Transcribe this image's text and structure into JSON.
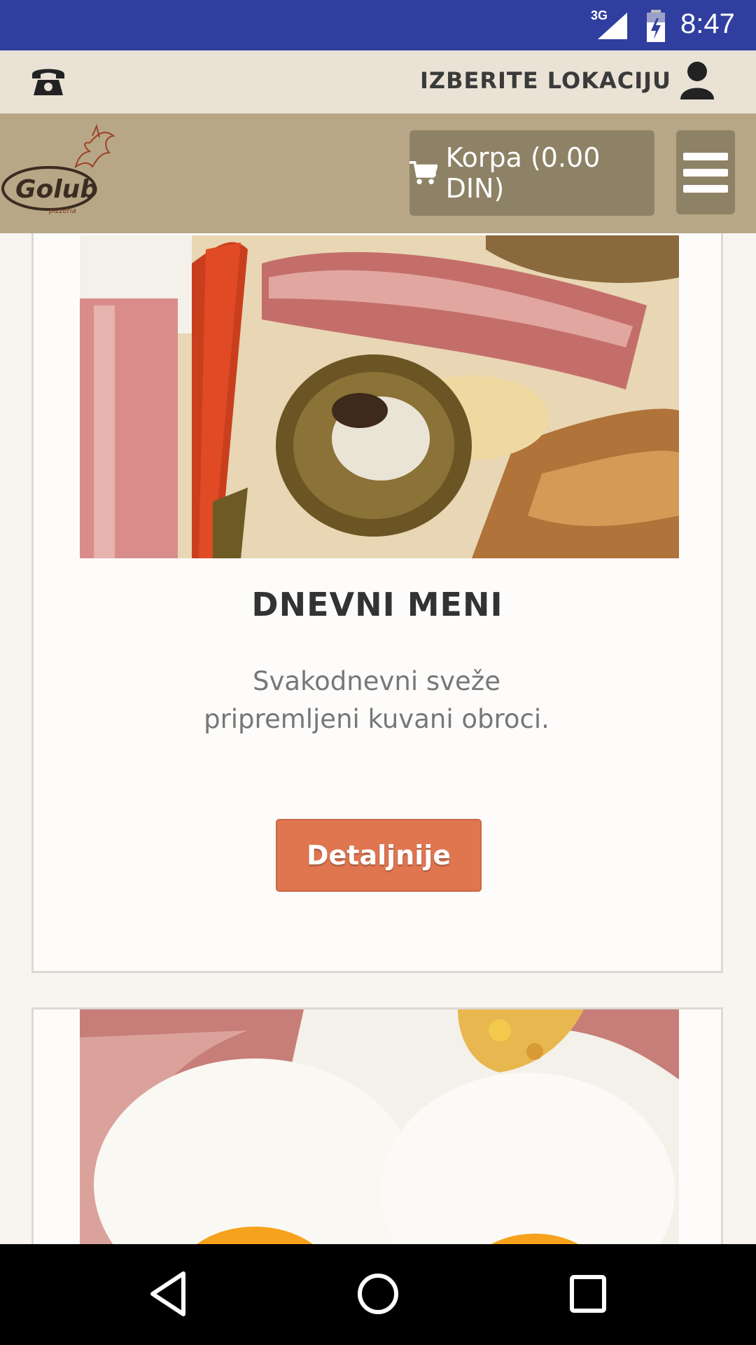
{
  "status_bar": {
    "network": "3G",
    "time": "8:47",
    "icons": [
      "signal-icon",
      "battery-icon"
    ]
  },
  "top_bar": {
    "phone_icon": "phone-icon",
    "location_label": "IZBERITE LOKACIJU",
    "user_icon": "user-icon"
  },
  "header": {
    "logo_text": "Golub",
    "logo_subtext": "pizzeria",
    "cart_icon": "cart-icon",
    "cart_label": "Korpa (0.00 DIN)",
    "menu_icon": "hamburger-menu-icon"
  },
  "cards": [
    {
      "image": "pizza-photo",
      "title": "DNEVNI MENI",
      "description": "Svakodnevni sveže pripremljeni kuvani obroci.",
      "button": "Detaljnije"
    },
    {
      "image": "eggs-bacon-photo"
    }
  ],
  "nav_bar": {
    "icons": [
      "back-icon",
      "home-icon",
      "recents-icon"
    ]
  }
}
